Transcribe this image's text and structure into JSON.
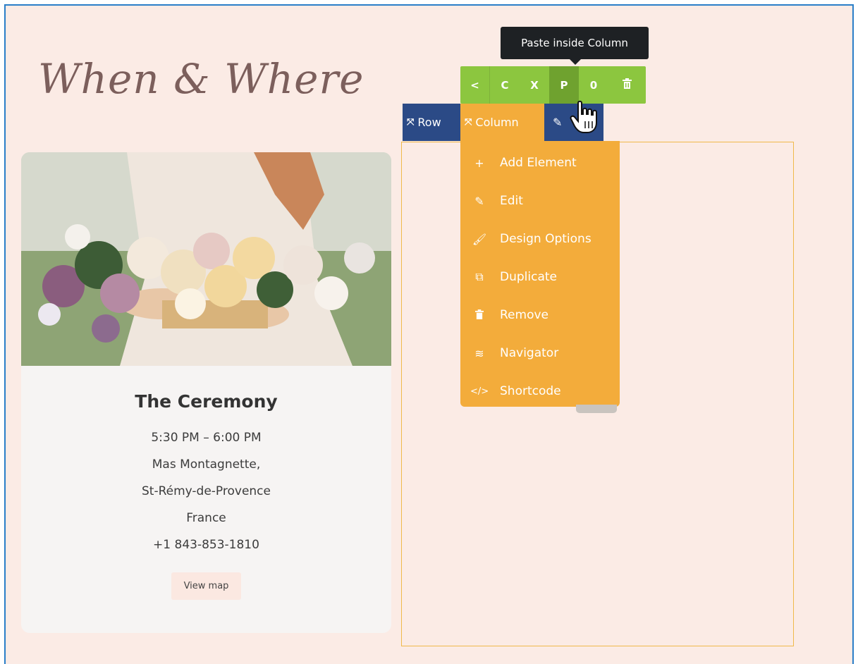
{
  "heading": "When & Where",
  "card": {
    "title": "The Ceremony",
    "time": "5:30 PM – 6:00 PM",
    "venue": "Mas Montagnette,",
    "town": "St-Rémy-de-Provence",
    "country": "France",
    "phone": "+1 843-853-1810",
    "button": "View map"
  },
  "tooltip": "Paste inside Column",
  "toolbar": {
    "back": "<",
    "copy": "C",
    "cut": "X",
    "paste": "P",
    "zero": "0"
  },
  "tabs": {
    "row": "Row",
    "column": "Column"
  },
  "menu": [
    {
      "label": "Add Element",
      "icon": "plus-icon"
    },
    {
      "label": "Edit",
      "icon": "pencil-icon"
    },
    {
      "label": "Design Options",
      "icon": "brush-icon"
    },
    {
      "label": "Duplicate",
      "icon": "duplicate-icon"
    },
    {
      "label": "Remove",
      "icon": "trash-icon"
    },
    {
      "label": "Navigator",
      "icon": "layers-icon"
    },
    {
      "label": "Shortcode",
      "icon": "code-icon"
    }
  ],
  "colors": {
    "canvas": "#fbebe5",
    "green": "#8cc63f",
    "blue": "#2b4a86",
    "orange": "#f3ac3b",
    "tooltip": "#1e2124"
  }
}
